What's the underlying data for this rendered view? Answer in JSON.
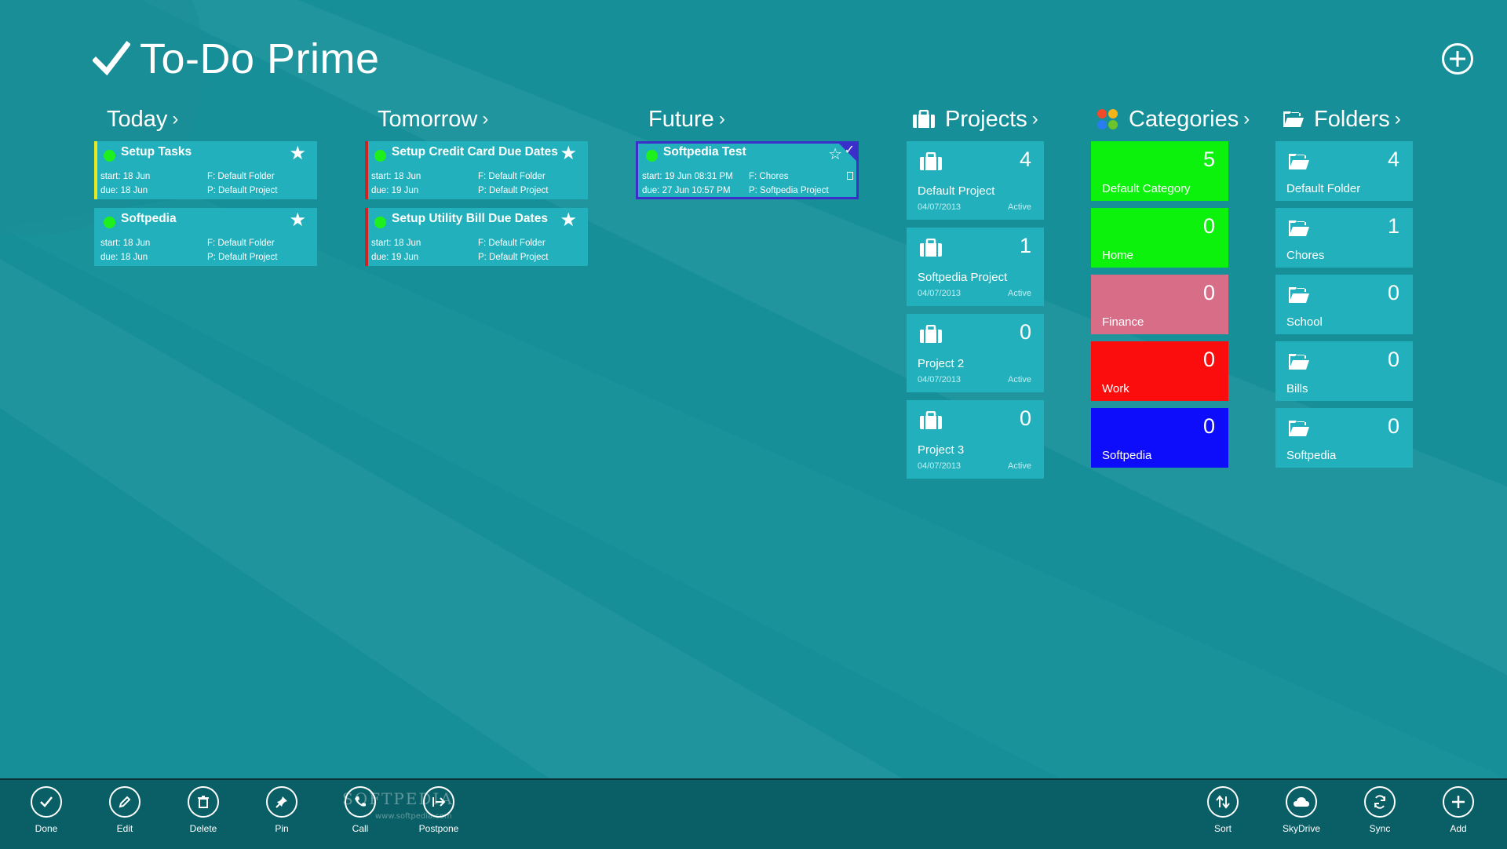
{
  "app": {
    "title": "To-Do Prime"
  },
  "sections": {
    "today": "Today",
    "tomorrow": "Tomorrow",
    "future": "Future",
    "projects": "Projects",
    "categories": "Categories",
    "folders": "Folders"
  },
  "today_tasks": [
    {
      "title": "Setup Tasks",
      "start": "start: 18 Jun",
      "due": "due: 18 Jun",
      "folder": "F: Default Folder",
      "project": "P: Default Project",
      "priority_color": "#e6ea1e"
    },
    {
      "title": "Softpedia",
      "start": "start: 18 Jun",
      "due": "due: 18 Jun",
      "folder": "F: Default Folder",
      "project": "P: Default Project",
      "priority_color": "#22b1bc"
    }
  ],
  "tomorrow_tasks": [
    {
      "title": "Setup Credit Card Due Dates",
      "start": "start: 18 Jun",
      "due": "due: 19 Jun",
      "folder": "F: Default Folder",
      "project": "P: Default Project",
      "priority_color": "#d22020"
    },
    {
      "title": "Setup Utility Bill Due Dates",
      "start": "start: 18 Jun",
      "due": "due: 19 Jun",
      "folder": "F: Default Folder",
      "project": "P: Default Project",
      "priority_color": "#d22020"
    }
  ],
  "future_tasks": [
    {
      "title": "Softpedia Test",
      "start": "start: 19 Jun   08:31 PM",
      "due": "due: 27 Jun   10:57 PM",
      "folder": "F: Chores",
      "project": "P: Softpedia Project",
      "selected": true
    }
  ],
  "projects": [
    {
      "name": "Default Project",
      "count": "4",
      "date": "04/07/2013",
      "status": "Active"
    },
    {
      "name": "Softpedia Project",
      "count": "1",
      "date": "04/07/2013",
      "status": "Active"
    },
    {
      "name": "Project 2",
      "count": "0",
      "date": "04/07/2013",
      "status": "Active"
    },
    {
      "name": "Project 3",
      "count": "0",
      "date": "04/07/2013",
      "status": "Active"
    }
  ],
  "categories": [
    {
      "name": "Default Category",
      "count": "5",
      "color": "#0df20d"
    },
    {
      "name": "Home",
      "count": "0",
      "color": "#0df20d"
    },
    {
      "name": "Finance",
      "count": "0",
      "color": "#d86d88"
    },
    {
      "name": "Work",
      "count": "0",
      "color": "#fb0d0d"
    },
    {
      "name": "Softpedia",
      "count": "0",
      "color": "#0d0dfb"
    }
  ],
  "folders": [
    {
      "name": "Default Folder",
      "count": "4"
    },
    {
      "name": "Chores",
      "count": "1"
    },
    {
      "name": "School",
      "count": "0"
    },
    {
      "name": "Bills",
      "count": "0"
    },
    {
      "name": "Softpedia",
      "count": "0"
    }
  ],
  "appbar": {
    "left": [
      {
        "label": "Done",
        "icon": "check-icon"
      },
      {
        "label": "Edit",
        "icon": "pencil-icon"
      },
      {
        "label": "Delete",
        "icon": "trash-icon"
      },
      {
        "label": "Pin",
        "icon": "pin-icon"
      },
      {
        "label": "Call",
        "icon": "phone-icon"
      },
      {
        "label": "Postpone",
        "icon": "postpone-icon"
      }
    ],
    "right": [
      {
        "label": "Sort",
        "icon": "sort-icon"
      },
      {
        "label": "SkyDrive",
        "icon": "cloud-icon"
      },
      {
        "label": "Sync",
        "icon": "sync-icon"
      },
      {
        "label": "Add",
        "icon": "plus-icon"
      }
    ]
  },
  "watermark": {
    "text": "SOFTPEDIA",
    "url": "www.softpedia.com"
  },
  "colors": {
    "background": "#178f98",
    "tile": "#22b1bc",
    "appbar": "#0a5f66",
    "selection": "#3b2fc9"
  }
}
